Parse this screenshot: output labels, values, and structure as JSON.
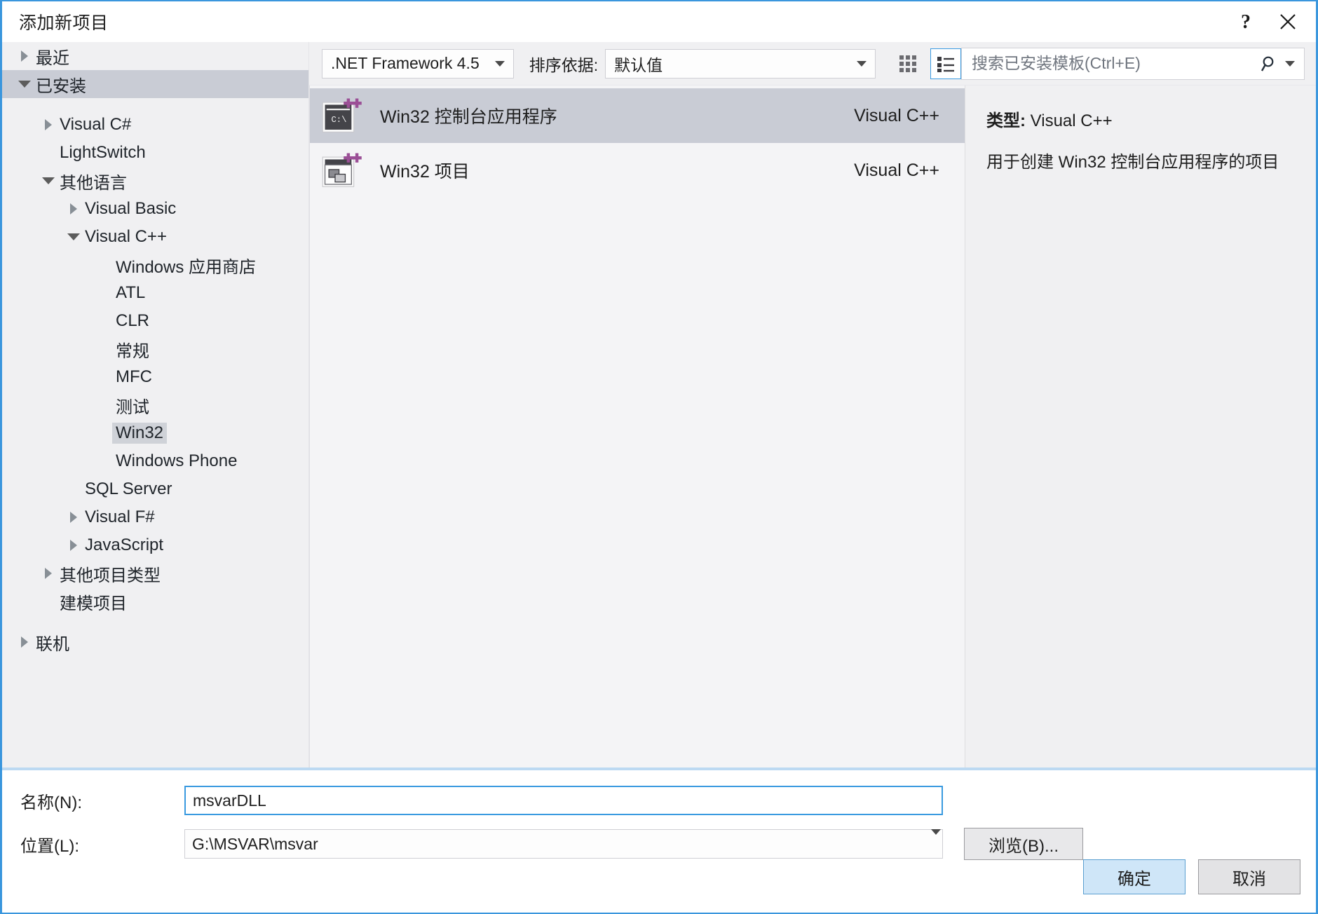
{
  "window": {
    "title": "添加新项目",
    "help_label": "?",
    "close_label": "✕"
  },
  "tree": {
    "items": [
      {
        "label": "最近",
        "level": 0,
        "arrow": "right",
        "selected": false
      },
      {
        "label": "已安装",
        "level": 0,
        "arrow": "down",
        "selected": true
      },
      {
        "label": "Visual C#",
        "level": 1,
        "arrow": "right",
        "selected": false
      },
      {
        "label": "LightSwitch",
        "level": 1,
        "arrow": "none",
        "selected": false
      },
      {
        "label": "其他语言",
        "level": 1,
        "arrow": "down",
        "selected": false
      },
      {
        "label": "Visual Basic",
        "level": 2,
        "arrow": "right",
        "selected": false
      },
      {
        "label": "Visual C++",
        "level": 2,
        "arrow": "down",
        "selected": false
      },
      {
        "label": "Windows 应用商店",
        "level": 3,
        "arrow": "none",
        "selected": false
      },
      {
        "label": "ATL",
        "level": 3,
        "arrow": "none",
        "selected": false
      },
      {
        "label": "CLR",
        "level": 3,
        "arrow": "none",
        "selected": false
      },
      {
        "label": "常规",
        "level": 3,
        "arrow": "none",
        "selected": false
      },
      {
        "label": "MFC",
        "level": 3,
        "arrow": "none",
        "selected": false
      },
      {
        "label": "测试",
        "level": 3,
        "arrow": "none",
        "selected": false
      },
      {
        "label": "Win32",
        "level": 3,
        "arrow": "none",
        "selected": true
      },
      {
        "label": "Windows Phone",
        "level": 3,
        "arrow": "none",
        "selected": false
      },
      {
        "label": "SQL Server",
        "level": 2,
        "arrow": "none",
        "selected": false
      },
      {
        "label": "Visual F#",
        "level": 2,
        "arrow": "right",
        "selected": false
      },
      {
        "label": "JavaScript",
        "level": 2,
        "arrow": "right",
        "selected": false
      },
      {
        "label": "其他项目类型",
        "level": 1,
        "arrow": "right",
        "selected": false
      },
      {
        "label": "建模项目",
        "level": 1,
        "arrow": "none",
        "selected": false
      },
      {
        "label": "联机",
        "level": 0,
        "arrow": "right",
        "selected": false
      }
    ]
  },
  "toolbar": {
    "framework": {
      "value": ".NET Framework 4.5",
      "icon": "chevron-down-icon"
    },
    "sort": {
      "label": "排序依据:",
      "value": "默认值",
      "icon": "chevron-down-icon"
    },
    "view_grid": {
      "icon": "grid-view-icon",
      "active": false
    },
    "view_list": {
      "icon": "list-view-icon",
      "active": true
    },
    "search": {
      "placeholder": "搜索已安装模板(Ctrl+E)",
      "value": "",
      "icon": "search-icon",
      "chevron": "chevron-down-icon"
    }
  },
  "templates": {
    "rows": [
      {
        "name": "Win32 控制台应用程序",
        "language": "Visual C++",
        "icon": "win32-console-app-icon",
        "selected": true
      },
      {
        "name": "Win32 项目",
        "language": "Visual C++",
        "icon": "win32-project-icon",
        "selected": false
      }
    ]
  },
  "description": {
    "type_label": "类型:",
    "type_value": "Visual C++",
    "text": "用于创建 Win32 控制台应用程序的项目"
  },
  "form": {
    "name_label": "名称(N):",
    "name_value": "msvarDLL",
    "location_label": "位置(L):",
    "location_value": "G:\\MSVAR\\msvar",
    "browse_label": "浏览(B)...",
    "ok_label": "确定",
    "cancel_label": "取消"
  },
  "colors": {
    "accent": "#3a96dd",
    "selection": "#c9ccd5",
    "panel": "#f0f0f2",
    "list_bg": "#f4f4f6",
    "default_button": "#cfe6f8",
    "icon_purple": "#9b4f96",
    "icon_dark": "#404040"
  }
}
